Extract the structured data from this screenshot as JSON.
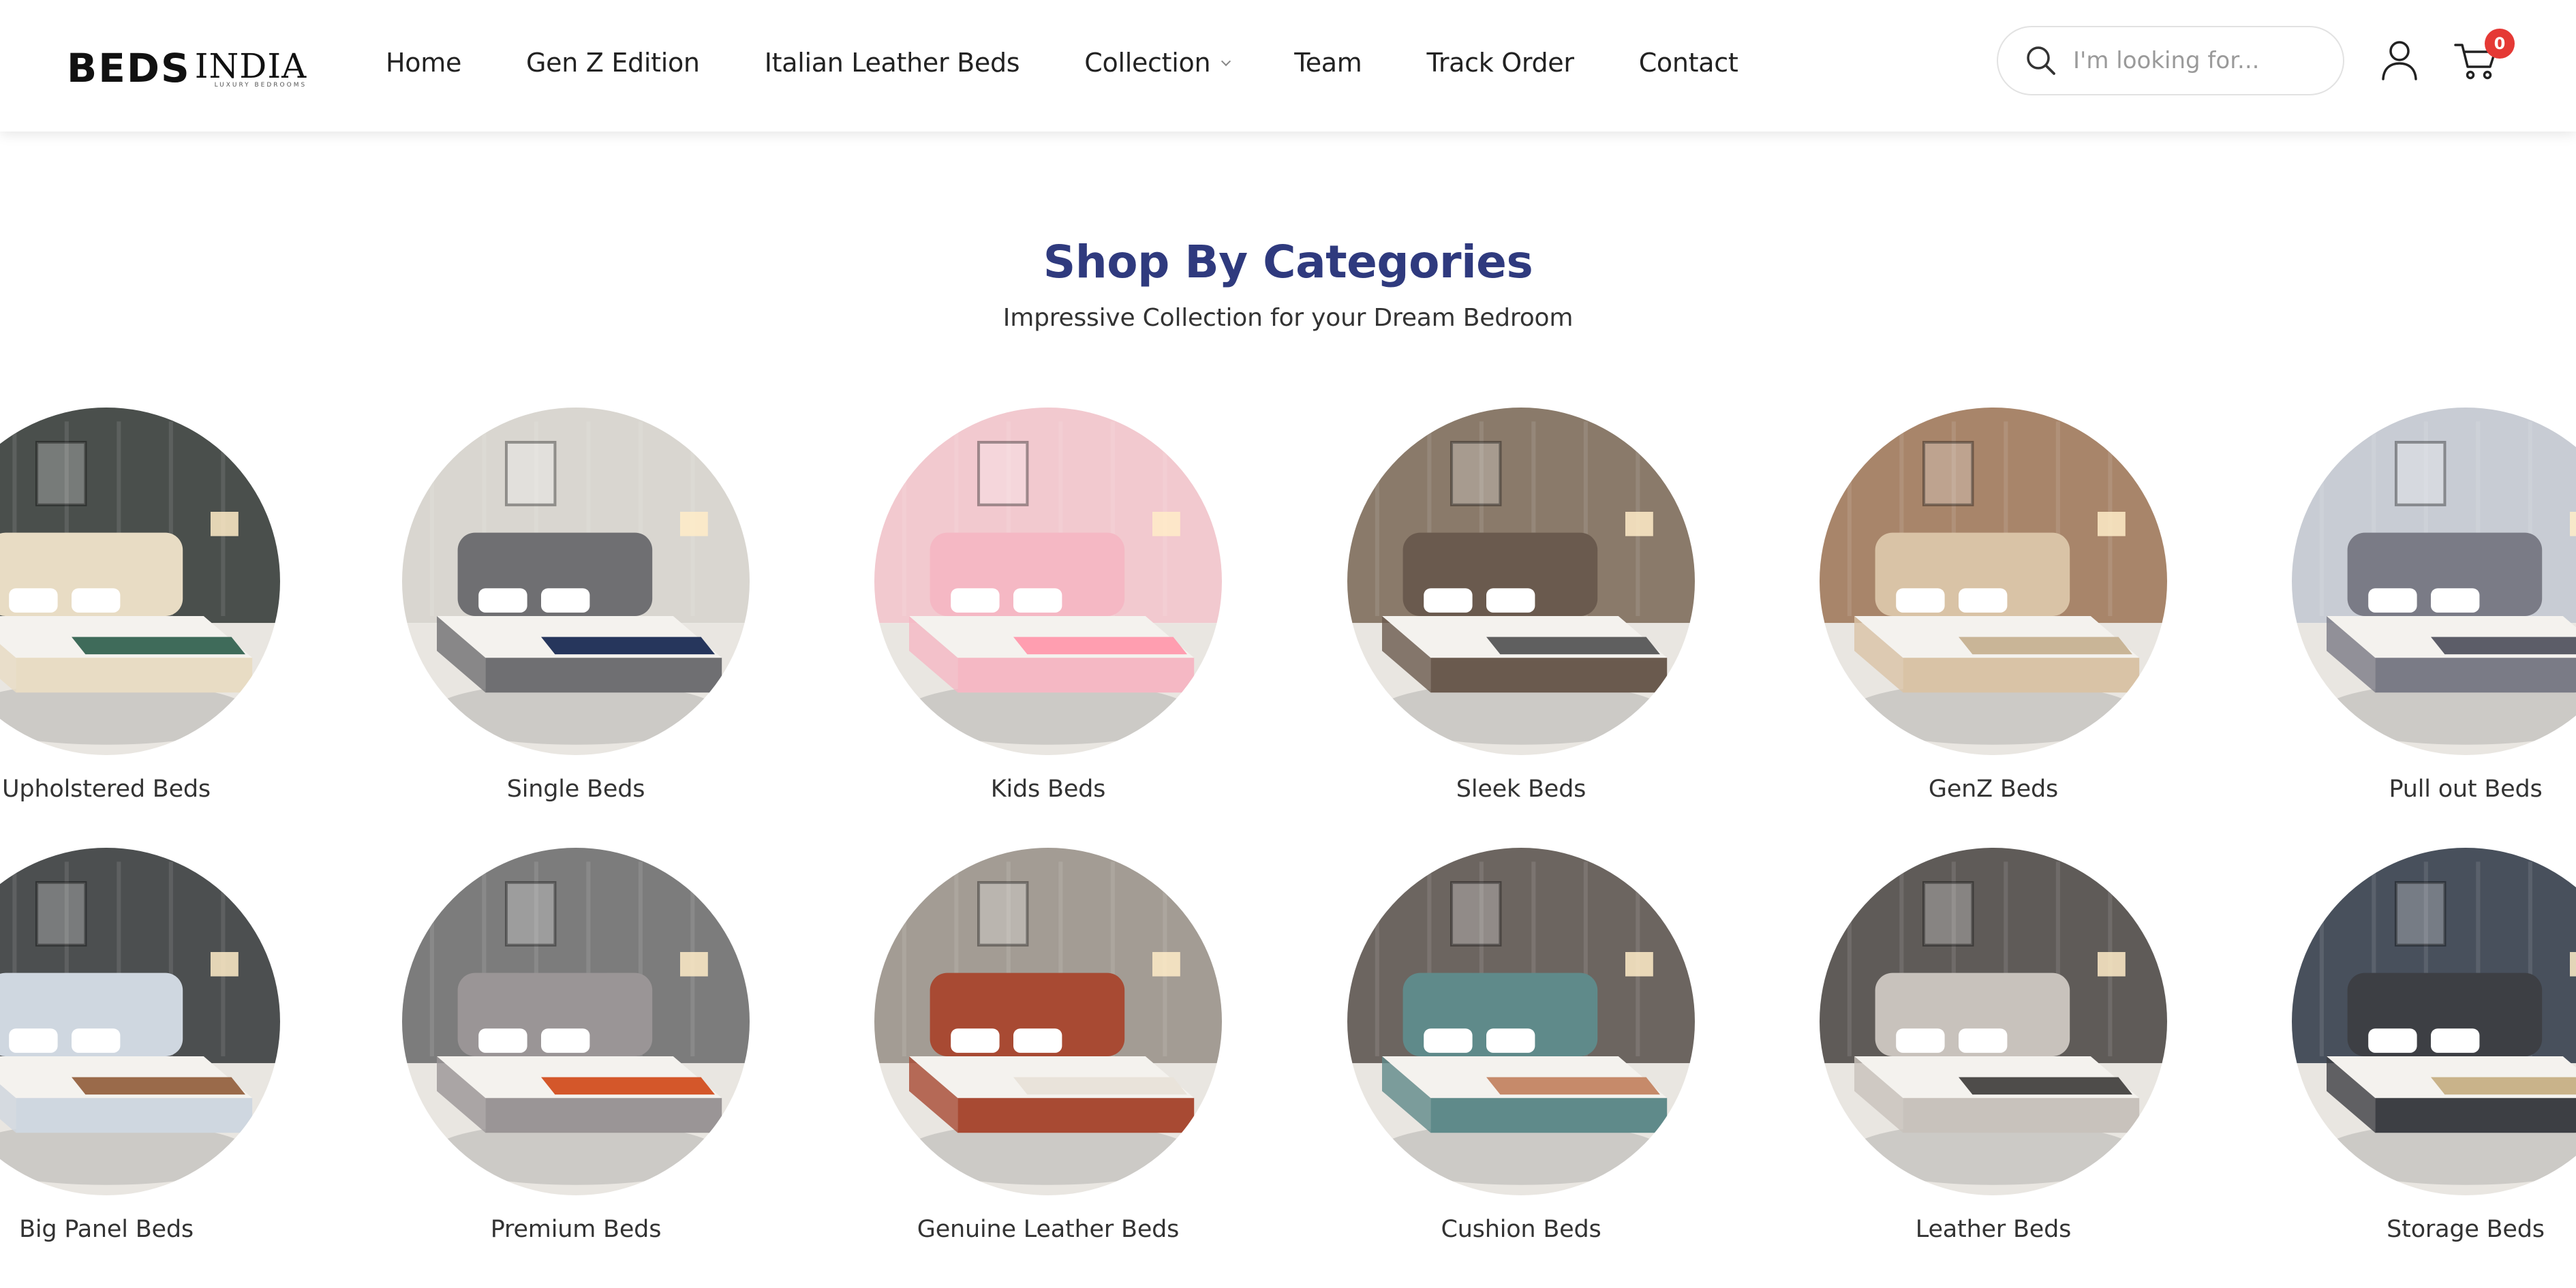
{
  "header": {
    "logo": {
      "main": "BEDS",
      "sub": "INDIA",
      "tagline": "LUXURY BEDROOMS"
    },
    "nav": [
      {
        "label": "Home"
      },
      {
        "label": "Gen Z Edition"
      },
      {
        "label": "Italian Leather Beds"
      },
      {
        "label": "Collection",
        "has_dropdown": true
      },
      {
        "label": "Team"
      },
      {
        "label": "Track Order"
      },
      {
        "label": "Contact"
      }
    ],
    "search": {
      "placeholder": "I'm looking for..."
    },
    "cart_count": "0"
  },
  "section": {
    "title": "Shop By Categories",
    "subtitle": "Impressive Collection for your Dream Bedroom"
  },
  "categories": [
    {
      "label": "Upholstered Beds",
      "wall": "#4a4f4c",
      "bed": "#e8dcc4",
      "accent": "#3f6b5a"
    },
    {
      "label": "Single Beds",
      "wall": "#d9d6d0",
      "bed": "#6f6f72",
      "accent": "#26365c"
    },
    {
      "label": "Kids Beds",
      "wall": "#f2c9cf",
      "bed": "#f5b8c4",
      "accent": "#ff9eb0"
    },
    {
      "label": "Sleek Beds",
      "wall": "#8a7a6a",
      "bed": "#6a5a4e",
      "accent": "#5f5f5f"
    },
    {
      "label": "GenZ Beds",
      "wall": "#a8856a",
      "bed": "#d9c3a6",
      "accent": "#c9b597"
    },
    {
      "label": "Pull out Beds",
      "wall": "#c8ccd4",
      "bed": "#7a7b86",
      "accent": "#5c5d68"
    },
    {
      "label": "Big Panel Beds",
      "wall": "#4c4f50",
      "bed": "#cfd7e0",
      "accent": "#9a6a4a"
    },
    {
      "label": "Premium Beds",
      "wall": "#7c7c7c",
      "bed": "#9a9596",
      "accent": "#d4572a"
    },
    {
      "label": "Genuine Leather Beds",
      "wall": "#a39c94",
      "bed": "#a84a33",
      "accent": "#e9e3da"
    },
    {
      "label": "Cushion Beds",
      "wall": "#6c6560",
      "bed": "#5f8a8a",
      "accent": "#c68a6a"
    },
    {
      "label": "Leather Beds",
      "wall": "#5f5b58",
      "bed": "#c8c2bc",
      "accent": "#4e4c4a"
    },
    {
      "label": "Storage Beds",
      "wall": "#48505c",
      "bed": "#3d3f44",
      "accent": "#c9b38a"
    }
  ],
  "colors": {
    "title": "#2f3a7e",
    "badge": "#e53935"
  }
}
